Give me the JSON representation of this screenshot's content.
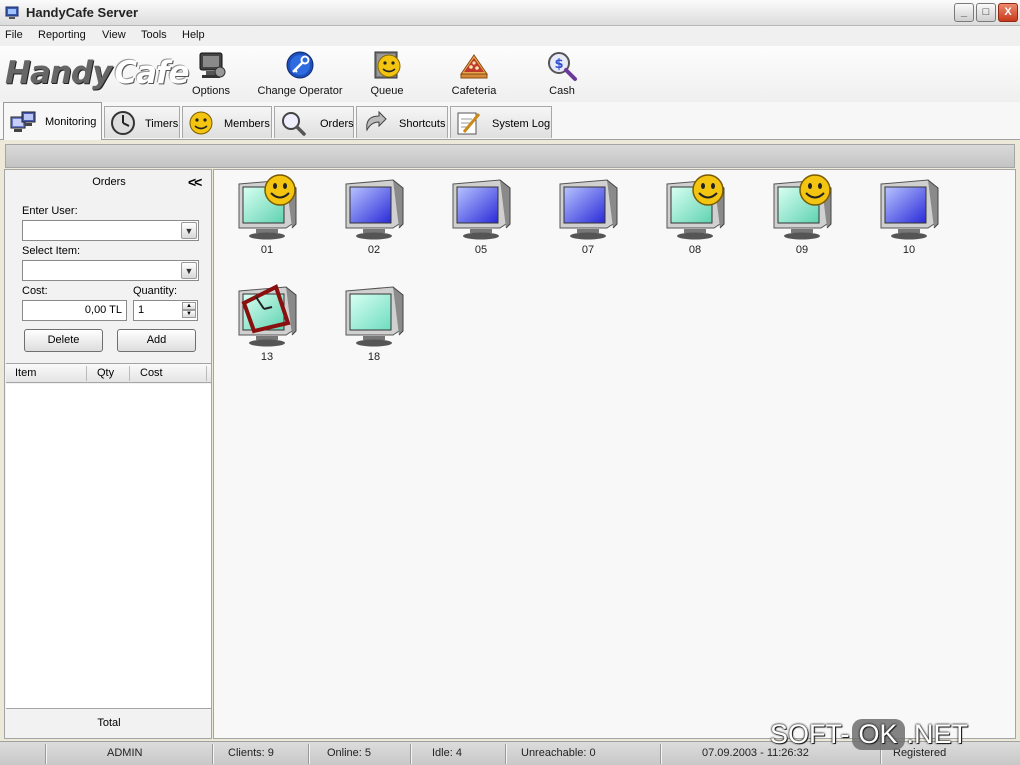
{
  "window": {
    "title": "HandyCafe Server",
    "minimize": "_",
    "maximize": "□",
    "close": "X"
  },
  "menu": [
    "File",
    "Reporting",
    "View",
    "Tools",
    "Help"
  ],
  "logo": {
    "part1": "Handy",
    "part2": "Cafe"
  },
  "toolbar": [
    {
      "label": "Options",
      "icon": "options-icon"
    },
    {
      "label": "Change Operator",
      "icon": "key-icon"
    },
    {
      "label": "Queue",
      "icon": "queue-icon"
    },
    {
      "label": "Cafeteria",
      "icon": "cafeteria-icon"
    },
    {
      "label": "Cash",
      "icon": "cash-icon"
    }
  ],
  "tabs": [
    {
      "label": "Monitoring",
      "active": true
    },
    {
      "label": "Timers"
    },
    {
      "label": "Members"
    },
    {
      "label": "Orders"
    },
    {
      "label": "Shortcuts"
    },
    {
      "label": "System Log"
    }
  ],
  "orders_panel": {
    "title": "Orders",
    "collapse": "<<",
    "enter_user_label": "Enter User:",
    "enter_user_value": "",
    "select_item_label": "Select Item:",
    "select_item_value": "",
    "cost_label": "Cost:",
    "cost_value": "0,00 TL",
    "quantity_label": "Quantity:",
    "quantity_value": "1",
    "delete_button": "Delete",
    "add_button": "Add",
    "columns": [
      "Item",
      "Qty",
      "Cost"
    ],
    "rows": [],
    "total_label": "Total"
  },
  "clients": [
    {
      "id": "01",
      "state": "user"
    },
    {
      "id": "02",
      "state": "idle"
    },
    {
      "id": "05",
      "state": "idle"
    },
    {
      "id": "07",
      "state": "idle"
    },
    {
      "id": "08",
      "state": "user"
    },
    {
      "id": "09",
      "state": "user"
    },
    {
      "id": "10",
      "state": "idle"
    },
    {
      "id": "13",
      "state": "timer"
    },
    {
      "id": "18",
      "state": "available"
    }
  ],
  "statusbar": {
    "operator": "ADMIN",
    "clients": "Clients: 9",
    "online": "Online: 5",
    "idle": "Idle: 4",
    "unreachable": "Unreachable: 0",
    "datetime": "07.09.2003 - 11:26:32",
    "registered": "Registered"
  },
  "watermark": {
    "left": "SOFT-",
    "ok": "OK",
    "right": ".NET"
  },
  "colors": {
    "screen_user": "#5fd2b0",
    "screen_idle": "#2a2ad8",
    "screen_available": "#6edcc0",
    "smiley": "#f3c410",
    "close_button": "#c8391b"
  }
}
